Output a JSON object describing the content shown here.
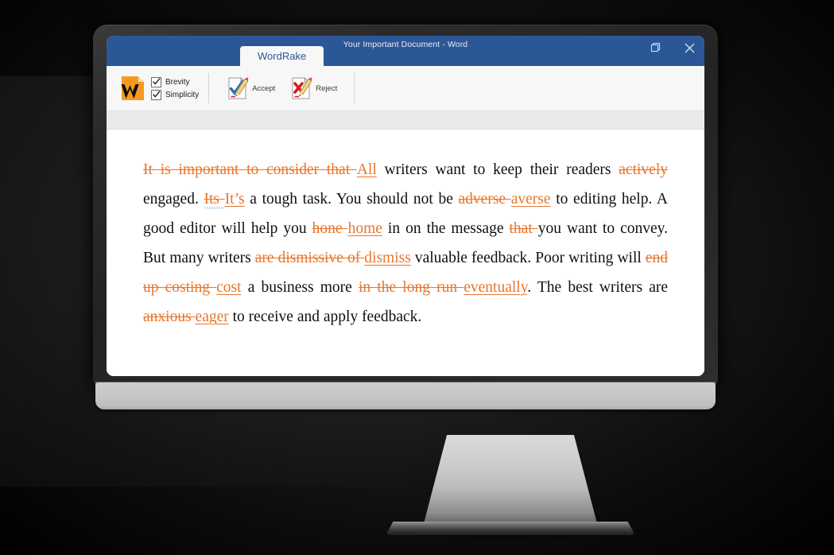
{
  "window": {
    "title": "Your Important Document - Word",
    "titlebar_color": "#2b5797",
    "controls": [
      {
        "name": "restore",
        "glyph": "restore-icon"
      },
      {
        "name": "close",
        "glyph": "close-icon"
      }
    ]
  },
  "tabs": [
    {
      "id": "wordrake",
      "label": "WordRake",
      "active": true
    }
  ],
  "ribbon": {
    "logo": {
      "name": "wordrake-logo",
      "letter": "W",
      "page_color": "#f6991f",
      "letter_color": "#0d0d0d"
    },
    "options": [
      {
        "label": "Brevity",
        "checked": true
      },
      {
        "label": "Simplicity",
        "checked": true
      }
    ],
    "commands": [
      {
        "id": "accept",
        "label": "Accept",
        "icon": "accept-check-pencil-icon",
        "mark_color": "#2f6cb5"
      },
      {
        "id": "reject",
        "label": "Reject",
        "icon": "reject-x-pencil-icon",
        "mark_color": "#cc2026"
      }
    ]
  },
  "document": {
    "edit_color": "#e8762c",
    "text_color": "#0f0f0f",
    "runs": [
      {
        "type": "del",
        "text": "It is important to consider that "
      },
      {
        "type": "ins",
        "text": "All"
      },
      {
        "type": "keep",
        "text": " writers want to keep their readers "
      },
      {
        "type": "del",
        "text": "actively"
      },
      {
        "type": "keep",
        "text": " engaged. "
      },
      {
        "type": "del-spell",
        "text": "Its "
      },
      {
        "type": "ins",
        "text": "It’s"
      },
      {
        "type": "keep",
        "text": " a tough task. You should not be "
      },
      {
        "type": "del",
        "text": "adverse "
      },
      {
        "type": "ins",
        "text": "averse"
      },
      {
        "type": "keep",
        "text": " to editing help. A good editor will help you "
      },
      {
        "type": "del",
        "text": "hone "
      },
      {
        "type": "ins",
        "text": "home"
      },
      {
        "type": "keep",
        "text": " in on the message "
      },
      {
        "type": "del",
        "text": "that "
      },
      {
        "type": "keep",
        "text": "you want to convey. But many writers "
      },
      {
        "type": "del",
        "text": "are dismissive of "
      },
      {
        "type": "ins",
        "text": "dismiss"
      },
      {
        "type": "keep",
        "text": " valuable feedback. Poor writing will "
      },
      {
        "type": "del",
        "text": "end up costing "
      },
      {
        "type": "ins",
        "text": "cost"
      },
      {
        "type": "keep",
        "text": " a business more "
      },
      {
        "type": "del",
        "text": "in the long run "
      },
      {
        "type": "ins",
        "text": "eventually"
      },
      {
        "type": "keep",
        "text": ". The best writers are "
      },
      {
        "type": "del",
        "text": "anxious "
      },
      {
        "type": "ins",
        "text": "eager"
      },
      {
        "type": "keep",
        "text": " to receive and apply feedback."
      }
    ]
  }
}
